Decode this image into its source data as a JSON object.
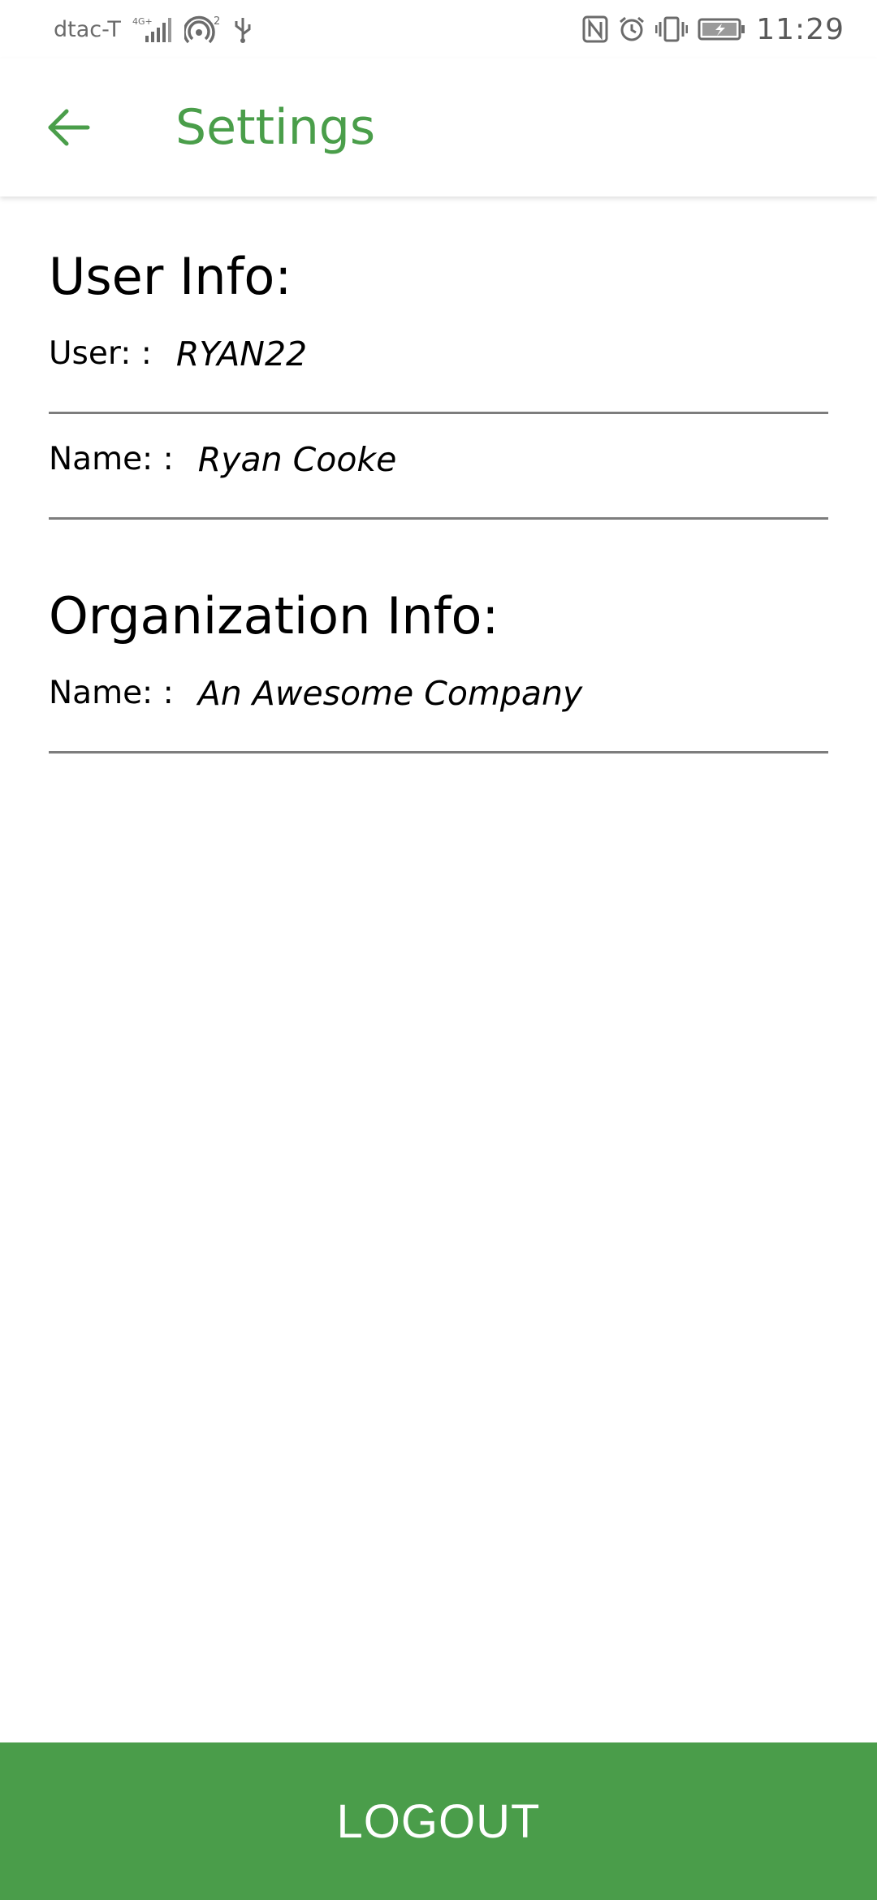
{
  "status_bar": {
    "carrier": "dtac-T",
    "network_badge": "4G+",
    "hotspot_count": "2",
    "time": "11:29",
    "icons": [
      "signal-icon",
      "hotspot-icon",
      "usb-icon",
      "nfc-icon",
      "alarm-icon",
      "vibrate-icon",
      "battery-icon"
    ]
  },
  "app_bar": {
    "back_icon": "arrow-left-icon",
    "title": "Settings"
  },
  "user_info": {
    "heading": "User Info:",
    "fields": [
      {
        "label": "User: :",
        "value": "RYAN22"
      },
      {
        "label": "Name: :",
        "value": "Ryan Cooke"
      }
    ]
  },
  "organization_info": {
    "heading": "Organization Info:",
    "fields": [
      {
        "label": "Name: :",
        "value": "An Awesome Company"
      }
    ]
  },
  "logout": {
    "label": "LOGOUT"
  },
  "colors": {
    "accent": "#4a9e4a",
    "divider": "#7d7d7d",
    "button_background": "#4a9d4a"
  }
}
